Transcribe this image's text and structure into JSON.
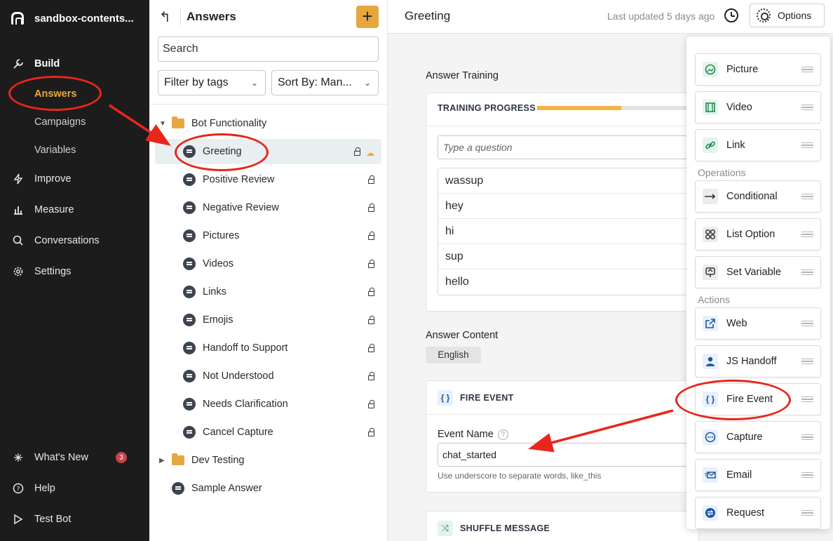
{
  "sidebar": {
    "workspace": "sandbox-contents...",
    "build": "Build",
    "sub_items": [
      "Answers",
      "Campaigns",
      "Variables"
    ],
    "improve": "Improve",
    "measure": "Measure",
    "conversations": "Conversations",
    "settings": "Settings",
    "whats_new": "What's New",
    "whats_new_count": "3",
    "help": "Help",
    "test_bot": "Test Bot"
  },
  "answers_panel": {
    "title": "Answers",
    "add_label": "+",
    "search_placeholder": "Search",
    "filter_label": "Filter by tags",
    "sort_label": "Sort By: Man...",
    "folder1": "Bot Functionality",
    "items": [
      "Greeting",
      "Positive Review",
      "Negative Review",
      "Pictures",
      "Videos",
      "Links",
      "Emojis",
      "Handoff to Support",
      "Not Understood",
      "Needs Clarification",
      "Cancel Capture"
    ],
    "folder2": "Dev Testing",
    "sample": "Sample Answer"
  },
  "main": {
    "title": "Greeting",
    "last_updated": "Last updated 5 days ago",
    "options_label": "Options",
    "answer_training": "Answer Training",
    "training_progress": "TRAINING PROGRESS",
    "training_progress_value": 0.5,
    "question_placeholder": "Type a question",
    "questions": [
      "wassup",
      "hey",
      "hi",
      "sup",
      "hello"
    ],
    "answer_content": "Answer Content",
    "language": "English",
    "fire_event_title": "FIRE EVENT",
    "event_name_label": "Event Name",
    "event_name_value": "chat_started",
    "event_help": "Use underscore to separate words, like_this",
    "shuffle_title": "SHUFFLE MESSAGE"
  },
  "palette": {
    "items_top": [
      "Picture",
      "Video",
      "Link"
    ],
    "operations_label": "Operations",
    "operations": [
      "Conditional",
      "List Option",
      "Set Variable"
    ],
    "actions_label": "Actions",
    "actions": [
      "Web",
      "JS Handoff",
      "Fire Event",
      "Capture",
      "Email",
      "Request"
    ]
  },
  "colors": {
    "accent": "#e6a740",
    "sidebar_bg": "#1c1c1c",
    "annotation_red": "#e8261c"
  }
}
